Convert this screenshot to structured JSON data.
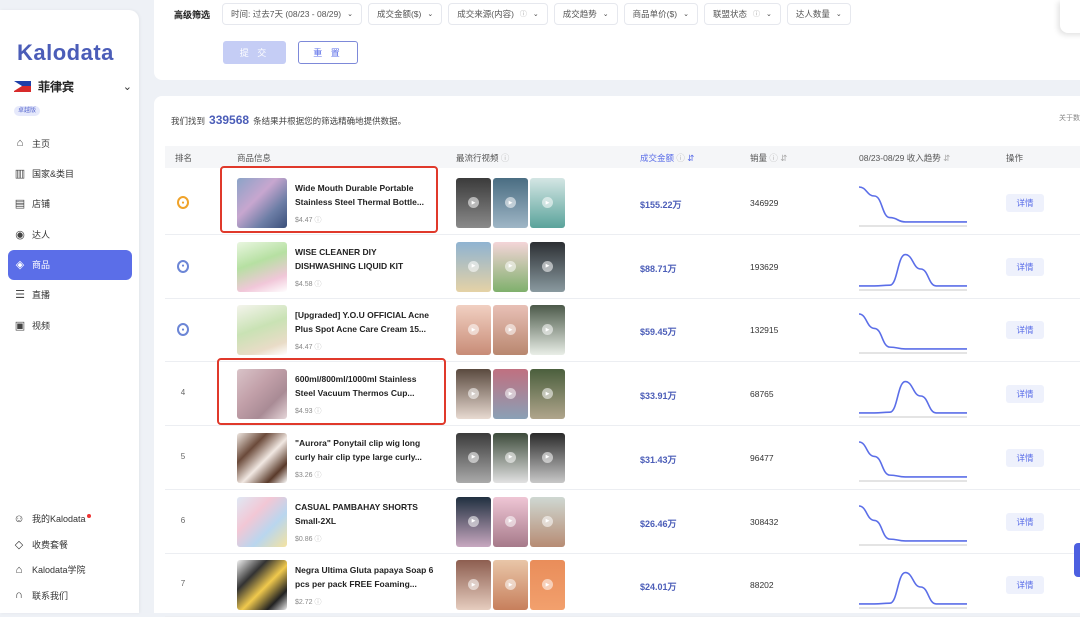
{
  "sidebar": {
    "logo": "Kalodata",
    "country": "菲律宾",
    "badge": "卓越版",
    "items": [
      {
        "label": "主页",
        "icon": "home-icon"
      },
      {
        "label": "国家&类目",
        "icon": "bank-icon"
      },
      {
        "label": "店铺",
        "icon": "store-icon"
      },
      {
        "label": "达人",
        "icon": "location-pin-icon"
      },
      {
        "label": "商品",
        "icon": "cube-icon",
        "active": true
      },
      {
        "label": "直播",
        "icon": "live-icon"
      },
      {
        "label": "视频",
        "icon": "video-icon"
      }
    ],
    "bottom": [
      {
        "label": "我的Kalodata",
        "icon": "user-icon"
      },
      {
        "label": "收费套餐",
        "icon": "diamond-icon"
      },
      {
        "label": "Kalodata学院",
        "icon": "graduation-cap-icon"
      },
      {
        "label": "联系我们",
        "icon": "headset-icon"
      }
    ]
  },
  "filters": {
    "title": "高级筛选",
    "chips": [
      "时间: 过去7天 (08/23 - 08/29)",
      "成交金额($)",
      "成交来源(内容)",
      "成交趋势",
      "商品单价($)",
      "联盟状态",
      "达人数量"
    ],
    "submit": "提 交",
    "reset": "重 置"
  },
  "results": {
    "prefix": "我们找到",
    "count": "339568",
    "suffix": "条结果并根据您的筛选精确地提供数据。",
    "about": "关于数",
    "headers": {
      "rank": "排名",
      "product": "商品信息",
      "videos": "最流行视频",
      "amount": "成交金额",
      "sales": "销量",
      "trend": "08/23-08/29 收入趋势",
      "action": "操作"
    },
    "detail_label": "详情",
    "rows": [
      {
        "rank": "",
        "medal": "gold",
        "title": "Wide Mouth Durable Portable Stainless Steel Thermal Bottle...",
        "price": "$4.47",
        "amount": "$155.22万",
        "sales": "346929",
        "trend": [
          1.0,
          0.75,
          0.15,
          0.03,
          0.03,
          0.03,
          0.03,
          0.03
        ],
        "highlight": true
      },
      {
        "rank": "",
        "medal": "silver",
        "title": "WISE CLEANER DIY DISHWASHING LIQUID KIT",
        "price": "$4.58",
        "amount": "$88.71万",
        "sales": "193629",
        "trend": [
          0.03,
          0.03,
          0.05,
          0.9,
          0.5,
          0.03,
          0.03,
          0.03
        ],
        "highlight": false
      },
      {
        "rank": "",
        "medal": "bronze",
        "title": "[Upgraded] Y.O.U OFFICIAL Acne Plus Spot Acne Care Cream 15...",
        "price": "$4.47",
        "amount": "$59.45万",
        "sales": "132915",
        "trend": [
          1.0,
          0.6,
          0.08,
          0.03,
          0.03,
          0.03,
          0.03,
          0.03
        ],
        "highlight": false
      },
      {
        "rank": "4",
        "medal": "",
        "title": "600ml/800ml/1000ml Stainless Steel Vacuum Thermos Cup...",
        "price": "$4.93",
        "amount": "$33.91万",
        "sales": "68765",
        "trend": [
          0.03,
          0.03,
          0.05,
          0.9,
          0.5,
          0.03,
          0.03,
          0.03
        ],
        "highlight": true
      },
      {
        "rank": "5",
        "medal": "",
        "title": "\"Aurora\" Ponytail clip wig long curly hair clip type large curly...",
        "price": "$3.26",
        "amount": "$31.43万",
        "sales": "96477",
        "trend": [
          1.0,
          0.6,
          0.08,
          0.03,
          0.03,
          0.03,
          0.03,
          0.03
        ],
        "highlight": false
      },
      {
        "rank": "6",
        "medal": "",
        "title": "CASUAL PAMBAHAY SHORTS Small-2XL",
        "price": "$0.86",
        "amount": "$26.46万",
        "sales": "308432",
        "trend": [
          1.0,
          0.6,
          0.08,
          0.03,
          0.03,
          0.03,
          0.03,
          0.03
        ],
        "highlight": false
      },
      {
        "rank": "7",
        "medal": "",
        "title": "Negra Ultima Gluta papaya Soap 6 pcs per pack FREE Foaming...",
        "price": "$2.72",
        "amount": "$24.01万",
        "sales": "88202",
        "trend": [
          0.03,
          0.03,
          0.05,
          0.9,
          0.5,
          0.03,
          0.03,
          0.03
        ],
        "highlight": false
      }
    ]
  },
  "colors": {
    "accent": "#5b6ee8",
    "highlight": "#e0392b",
    "trend": "#5b6ee8"
  }
}
